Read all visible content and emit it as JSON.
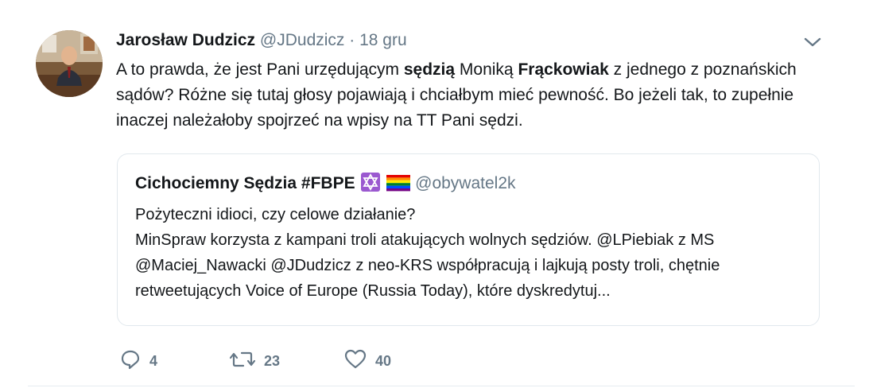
{
  "tweet": {
    "author_name": "Jarosław Dudzicz",
    "author_handle": "@JDudzicz",
    "separator": "·",
    "time": "18 gru",
    "text_parts": [
      "A to prawda, że jest Pani urzędującym ",
      "sędzią",
      " Moniką ",
      "Frąckowiak",
      " z jednego z poznańskich sądów? Różne się tutaj głosy pojawiają i chciałbym mieć pewność. Bo jeżeli tak, to zupełnie inaczej należałoby spojrzeć na wpisy na TT Pani sędzi."
    ]
  },
  "quoted": {
    "author_name": "Cichociemny Sędzia #FBPE",
    "author_handle": "@obywatel2k",
    "emojis": [
      "star-of-david-emoji",
      "rainbow-flag-emoji"
    ],
    "text_line1": "Pożyteczni idioci, czy celowe działanie?",
    "text_body": "MinSpraw korzysta z kampani troli atakujących wolnych sędziów. @LPiebiak z MS @Maciej_Nawacki @JDudzicz z neo-KRS współpracują i lajkują posty troli, chętnie retweetujących Voice of Europe (Russia Today), które dyskredytuj..."
  },
  "actions": {
    "replies": "4",
    "retweets": "23",
    "likes": "40"
  },
  "colors": {
    "text": "#14171a",
    "secondary": "#657786",
    "border": "#e1e8ed"
  }
}
